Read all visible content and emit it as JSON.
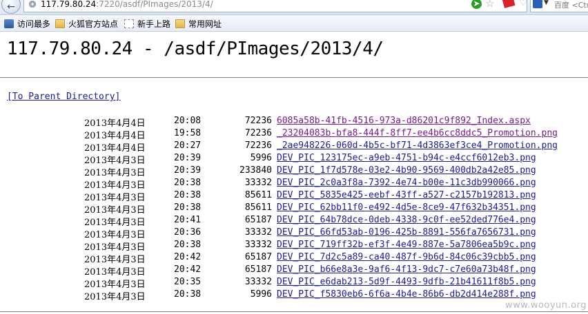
{
  "browser": {
    "url_host": "117.79.80.24",
    "url_path": ":7220/asdf/PImages/2013/4/",
    "search_text": "百度 <Ctr",
    "icons": [
      "back-icon",
      "site-icon",
      "go-icon",
      "star-icon",
      "flag-icon",
      "heart-icon",
      "dropdown-icon",
      "refresh-icon",
      "baidu-icon"
    ]
  },
  "bookmarks": [
    {
      "label": "访问最多",
      "icon": "most-visited-icon"
    },
    {
      "label": "火狐官方站点",
      "icon": "folder-icon"
    },
    {
      "label": "新手上路",
      "icon": "page-icon"
    },
    {
      "label": "常用网址",
      "icon": "folder-icon"
    }
  ],
  "page": {
    "title": "117.79.80.24 - /asdf/PImages/2013/4/",
    "parent_link": "[To Parent Directory]",
    "link_color": "#1a1a9c",
    "visited_color": "#7a1a8c"
  },
  "files": [
    {
      "date": "2013年4月4日",
      "time": "20:08",
      "size": "72236",
      "name": "6085a58b-41fb-4516-973a-d86201c9f892_Index.aspx",
      "visited": true
    },
    {
      "date": "2013年4月4日",
      "time": "19:58",
      "size": "72236",
      "name": "_23204083b-bfa8-444f-8ff7-ee4b6cc8ddc5_Promotion.png",
      "visited": true
    },
    {
      "date": "2013年4月4日",
      "time": "20:27",
      "size": "72236",
      "name": "_2ae948226-060d-4b5c-bf71-4d3863ef3ce4_Promotion.png",
      "visited": false
    },
    {
      "date": "2013年4月3日",
      "time": "20:39",
      "size": "5996",
      "name": "DEV_PIC_123175ec-a9eb-4751-b94c-e4ccf6012eb3.png",
      "visited": false
    },
    {
      "date": "2013年4月3日",
      "time": "20:39",
      "size": "233840",
      "name": "DEV_PIC_1f7d578e-03e2-4b90-9569-400db2a42e85.png",
      "visited": false
    },
    {
      "date": "2013年4月3日",
      "time": "20:38",
      "size": "33332",
      "name": "DEV_PIC_2c0a3f8a-7392-4e74-b00e-11c3db990066.png",
      "visited": false
    },
    {
      "date": "2013年4月3日",
      "time": "20:38",
      "size": "85611",
      "name": "DEV_PIC_5835e425-eebf-43ff-a527-c2157b192813.png",
      "visited": false
    },
    {
      "date": "2013年4月3日",
      "time": "20:38",
      "size": "85611",
      "name": "DEV_PIC_62bb11f0-e492-4d5e-8ce9-47f632b34351.png",
      "visited": false
    },
    {
      "date": "2013年4月3日",
      "time": "20:41",
      "size": "65187",
      "name": "DEV_PIC_64b78dce-0deb-4338-9c0f-ee52ded776e4.png",
      "visited": false
    },
    {
      "date": "2013年4月3日",
      "time": "20:36",
      "size": "33332",
      "name": "DEV_PIC_66fd53ab-0196-425b-8891-556fa7656731.png",
      "visited": false
    },
    {
      "date": "2013年4月3日",
      "time": "20:38",
      "size": "33332",
      "name": "DEV_PIC_719ff32b-ef3f-4e49-887e-5a7806ea5b9c.png",
      "visited": false
    },
    {
      "date": "2013年4月3日",
      "time": "20:42",
      "size": "65187",
      "name": "DEV_PIC_7d2c5a89-ca40-487f-9b6d-84c06c39cbb5.png",
      "visited": false
    },
    {
      "date": "2013年4月3日",
      "time": "20:42",
      "size": "65187",
      "name": "DEV_PIC_b66e8a3e-9af6-4f13-9dc7-c7e60a73b48f.png",
      "visited": false
    },
    {
      "date": "2013年4月3日",
      "time": "20:35",
      "size": "33332",
      "name": "DEV_PIC_e6dab213-5d9f-4493-9dfb-21b41611f8b5.png",
      "visited": false
    },
    {
      "date": "2013年4月3日",
      "time": "20:38",
      "size": "5996",
      "name": "DEV_PIC_f5830eb6-6f6a-4b4e-86b6-db2d414e288f.png",
      "visited": false
    }
  ],
  "watermark": "www.wooyun.org"
}
